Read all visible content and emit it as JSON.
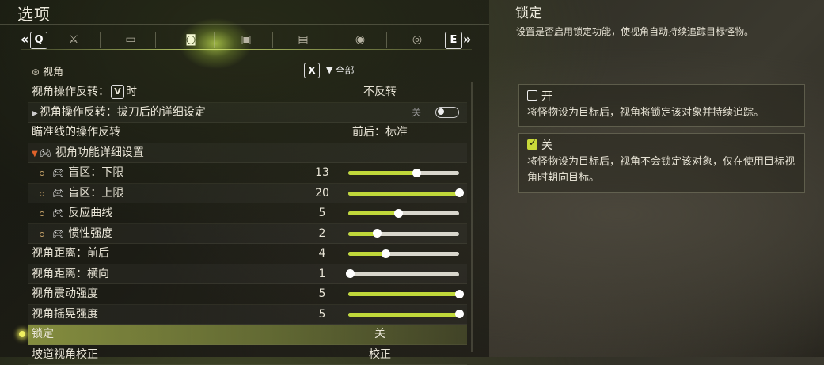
{
  "header": {
    "title": "选项"
  },
  "tabs": {
    "prev_key": "Q",
    "next_key": "E",
    "prev_arrow": "«",
    "next_arrow": "»",
    "items": [
      {
        "icon": "sword-icon"
      },
      {
        "icon": "controller-icon"
      },
      {
        "icon": "camera-icon",
        "active": true
      },
      {
        "icon": "monitor-icon"
      },
      {
        "icon": "image-icon"
      },
      {
        "icon": "speaker-icon"
      },
      {
        "icon": "accessibility-icon"
      }
    ]
  },
  "section": {
    "title": "视角",
    "filter_key": "X",
    "filter_label": "全部"
  },
  "rows": [
    {
      "label_pre": "视角操作反转：",
      "label_key": "V",
      "label_post": "时",
      "value": "不反转"
    },
    {
      "label": "视角操作反转：拔刀后的详细设定",
      "toggle_text": "关"
    },
    {
      "label": "瞄准线的操作反转",
      "value": "前后：标准"
    },
    {
      "label": "视角功能详细设置"
    },
    {
      "label": "盲区：下限",
      "num": "13",
      "level": 0.62
    },
    {
      "label": "盲区：上限",
      "num": "20",
      "level": 1.0
    },
    {
      "label": "反应曲线",
      "num": "5",
      "level": 0.45
    },
    {
      "label": "惯性强度",
      "num": "2",
      "level": 0.26
    },
    {
      "label": "视角距离：前后",
      "num": "4",
      "level": 0.34
    },
    {
      "label": "视角距离：横向",
      "num": "1",
      "level": 0.02
    },
    {
      "label": "视角震动强度",
      "num": "5",
      "level": 1.0
    },
    {
      "label": "视角摇晃强度",
      "num": "5",
      "level": 1.0
    },
    {
      "label": "锁定",
      "value": "关"
    },
    {
      "label": "坡道视角校正",
      "value": "校正"
    }
  ],
  "detail": {
    "title": "锁定",
    "description": "设置是否启用锁定功能，使视角自动持续追踪目标怪物。",
    "options": [
      {
        "label": "开",
        "checked": false,
        "description": "将怪物设为目标后，视角将锁定该对象并持续追踪。"
      },
      {
        "label": "关",
        "checked": true,
        "description": "将怪物设为目标后，视角不会锁定该对象，仅在使用目标视角时朝向目标。"
      }
    ]
  },
  "colors": {
    "accent": "#c0d83a",
    "selection": "#8f9a46"
  }
}
